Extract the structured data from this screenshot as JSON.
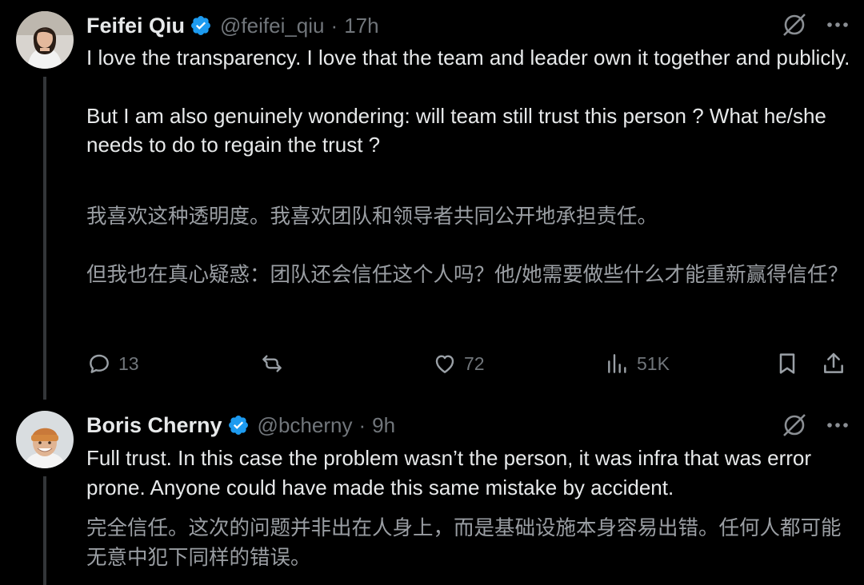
{
  "tweets": [
    {
      "author": {
        "name": "Feifei Qiu",
        "handle": "@feifei_qiu",
        "time": "17h"
      },
      "lines": [
        "I love the transparency. I love that the team and leader own it together and publicly.",
        "But I am also genuinely wondering: will team still trust this person ? What he/she needs to do to regain the trust ?"
      ],
      "translation": [
        "我喜欢这种透明度。我喜欢团队和领导者共同公开地承担责任。",
        "但我也在真心疑惑：团队还会信任这个人吗？他/她需要做些什么才能重新赢得信任？"
      ],
      "stats": {
        "replies": "13",
        "likes": "72",
        "views": "51K"
      }
    },
    {
      "author": {
        "name": "Boris Cherny",
        "handle": "@bcherny",
        "time": "9h"
      },
      "lines": [
        "Full trust. In this case the problem wasn’t the person, it was infra that was error prone. Anyone could have made this same mistake by accident."
      ],
      "translation": [
        "完全信任。这次的问题并非出在人身上，而是基础设施本身容易出错。任何人都可能无意中犯下同样的错误。"
      ]
    }
  ],
  "colors": {
    "background": "#000000",
    "text": "#e7e9ea",
    "muted": "#71767b",
    "verified": "#1d9bf0"
  }
}
